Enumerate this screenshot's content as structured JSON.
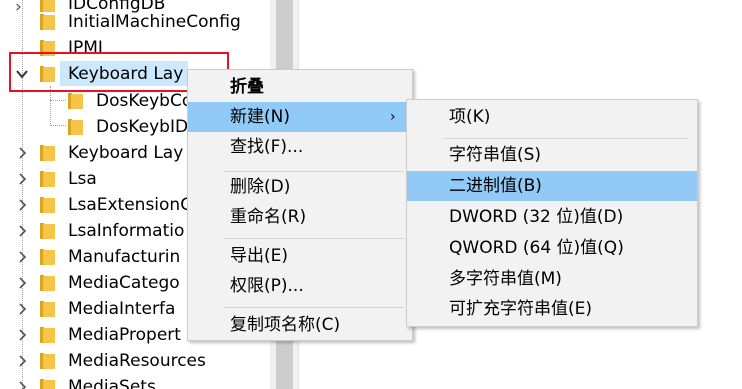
{
  "tree": {
    "items": [
      {
        "label": "IDConfigDB"
      },
      {
        "label": "InitialMachineConfig"
      },
      {
        "label": "IPMI"
      },
      {
        "label": "Keyboard Lay"
      },
      {
        "label": "DosKeybCo"
      },
      {
        "label": "DosKeybIDs"
      },
      {
        "label": "Keyboard Lay"
      },
      {
        "label": "Lsa"
      },
      {
        "label": "LsaExtensionC"
      },
      {
        "label": "LsaInformatio"
      },
      {
        "label": "Manufacturin"
      },
      {
        "label": "MediaCatego"
      },
      {
        "label": "MediaInterfa"
      },
      {
        "label": "MediaPropert"
      },
      {
        "label": "MediaResources"
      },
      {
        "label": "MediaSets"
      }
    ]
  },
  "context_menu": {
    "title": "折叠",
    "new": "新建(N)",
    "find": "查找(F)...",
    "delete": "删除(D)",
    "rename": "重命名(R)",
    "export": "导出(E)",
    "permissions": "权限(P)...",
    "copy_key_name": "复制项名称(C)"
  },
  "submenu": {
    "key": "项(K)",
    "string_value": "字符串值(S)",
    "binary_value": "二进制值(B)",
    "dword_value": "DWORD (32 位)值(D)",
    "qword_value": "QWORD (64 位)值(Q)",
    "multi_string_value": "多字符串值(M)",
    "expandable_string_value": "可扩充字符串值(E)"
  },
  "colors": {
    "highlight": "#91c9f7",
    "selection": "#cce8ff",
    "annotation_box": "#e81123",
    "folder": "#f6c447"
  }
}
